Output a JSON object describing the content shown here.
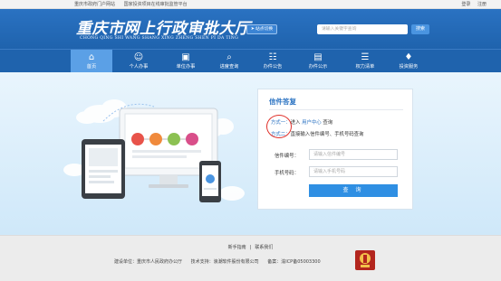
{
  "topbar": {
    "links": [
      "重庆市政府门户网站",
      "国家投资项目在线审批监管平台"
    ],
    "auth": [
      "登录",
      "注册"
    ]
  },
  "header": {
    "title_cn": "重庆市网上行政审批大厅",
    "title_en": "CHONG QING SHI WANG SHANG XING ZHENG SHEN PI DA TING",
    "switch_label": "站点切换",
    "search_placeholder": "请输入关键字查询",
    "search_button": "搜索"
  },
  "nav": {
    "items": [
      {
        "label": "首页",
        "icon": "home-icon"
      },
      {
        "label": "个人办事",
        "icon": "person-icon"
      },
      {
        "label": "单位办事",
        "icon": "briefcase-icon"
      },
      {
        "label": "进度查询",
        "icon": "search-progress-icon"
      },
      {
        "label": "办件公告",
        "icon": "announcement-icon"
      },
      {
        "label": "办件公示",
        "icon": "publicity-icon"
      },
      {
        "label": "权力清单",
        "icon": "list-icon"
      },
      {
        "label": "投资服务",
        "icon": "investment-icon"
      }
    ],
    "active_index": 0
  },
  "reply_card": {
    "title": "信件答复",
    "way1_label": "方式一：",
    "way1_pre": "进入",
    "way1_link": "用户中心",
    "way1_post": "查询",
    "way2_label": "方式二：",
    "way2_text": "直接输入信件编号、手机号码查询",
    "letter_no_label": "信件编号：",
    "letter_no_placeholder": "请输入信件编号",
    "phone_label": "手机号码：",
    "phone_placeholder": "请输入手机号码",
    "query_button": "查 询"
  },
  "footer": {
    "links": [
      "新手指南",
      "|",
      "联系我们"
    ],
    "organizer": "建设单位：重庆市人民政府办公厅",
    "support": "技术支持：浪潮软件股份有限公司",
    "icp": "备案：渝ICP备05003300",
    "emblem_icon": "party-government-emblem-icon"
  },
  "colors": {
    "brand_blue": "#1f63ad",
    "active_nav": "#5ba0e6",
    "button_blue": "#2f8fe3",
    "annotation_red": "#e0302a"
  }
}
